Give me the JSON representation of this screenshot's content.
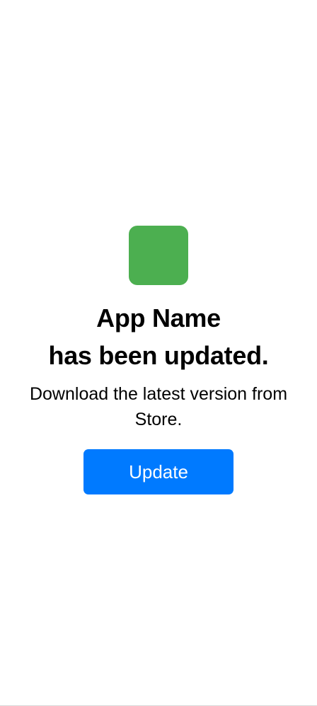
{
  "app": {
    "name": "App Name",
    "icon_color": "#4caf50"
  },
  "update_notice": {
    "title_line_2": "has been updated.",
    "message": "Download the latest version from Store.",
    "button_label": "Update",
    "button_color": "#007aff"
  }
}
